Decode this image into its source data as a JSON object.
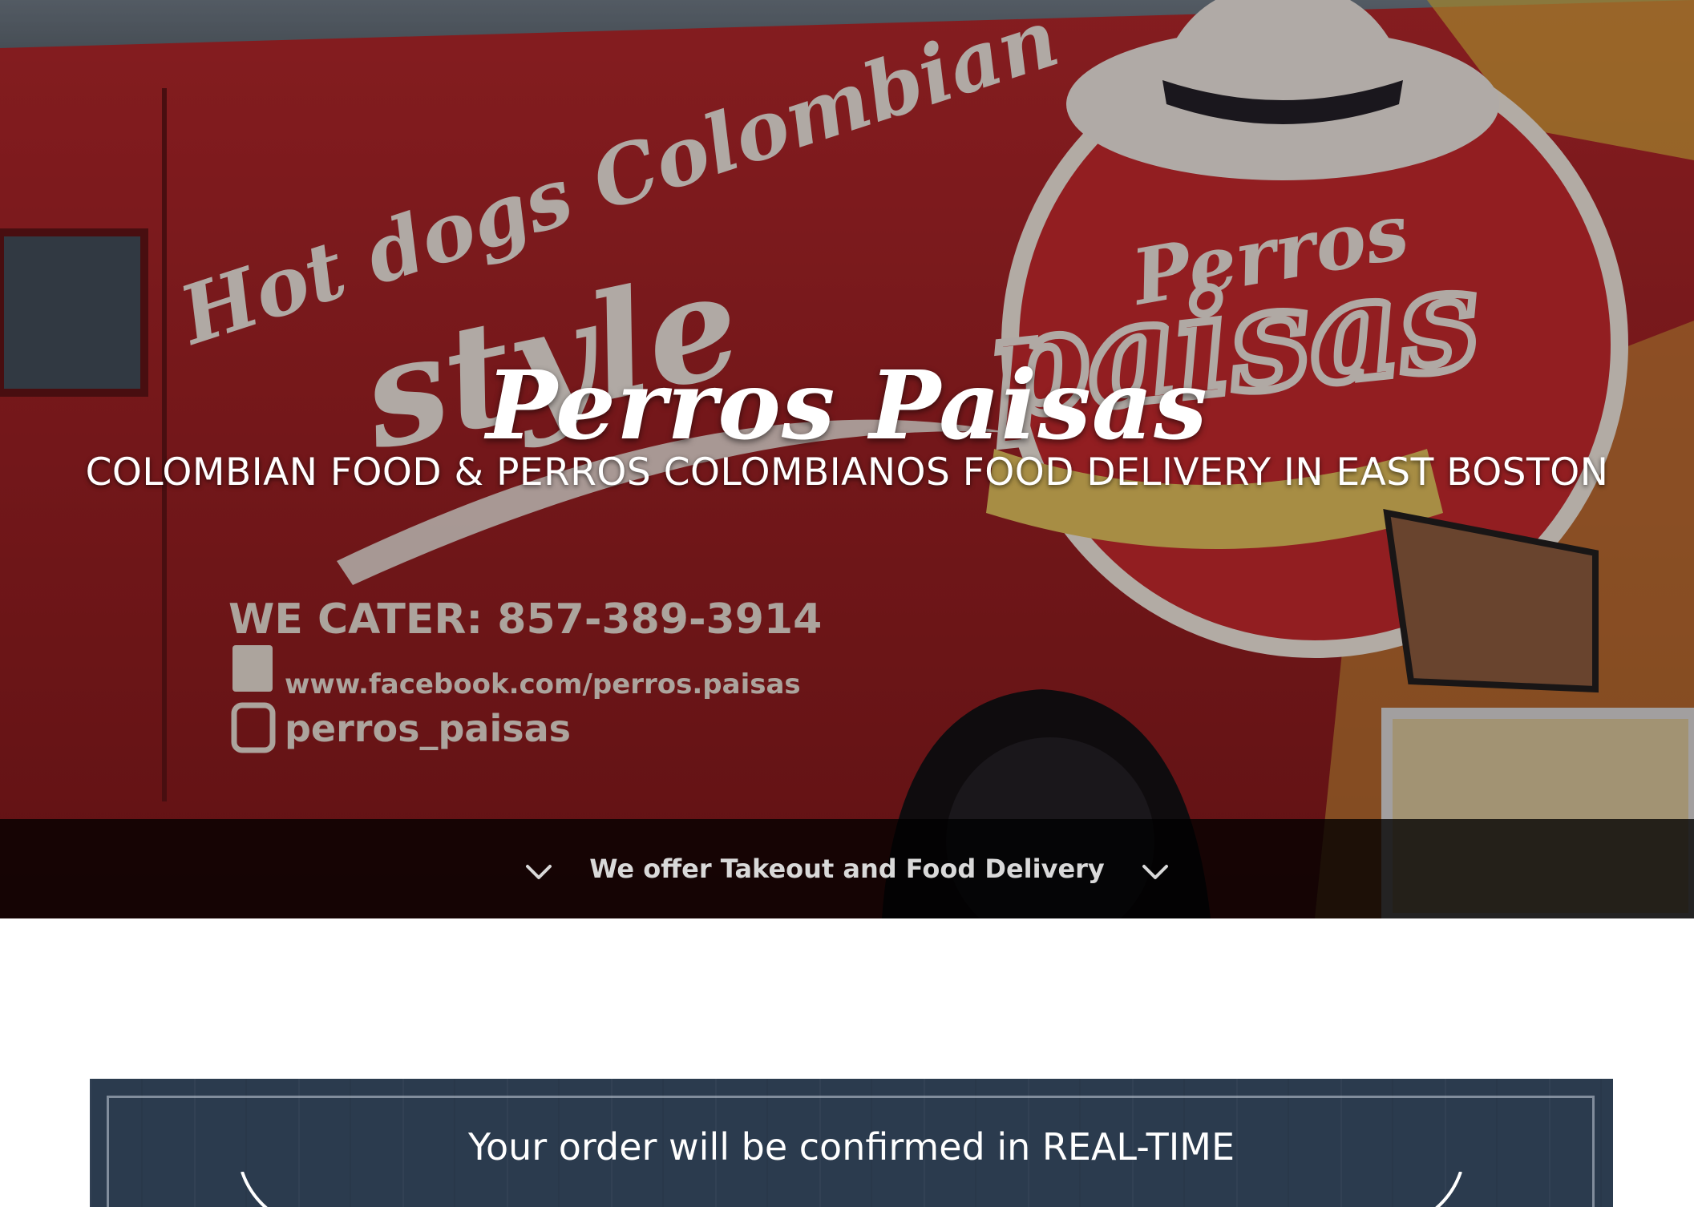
{
  "hero": {
    "title": "Perros Paisas",
    "subtitle": "COLOMBIAN FOOD & PERROS COLOMBIANOS FOOD DELIVERY IN EAST BOSTON",
    "bar_text": "We offer Takeout and Food Delivery",
    "truck_lettering": {
      "slogan_line1": "Hot dogs Colombian",
      "slogan_line2": "style",
      "cater_line": "WE CATER: 857-389-3914",
      "facebook": "www.facebook.com/perros.paisas",
      "instagram": "perros_paisas",
      "logo_top": "Perros",
      "logo_main": "paisas"
    }
  },
  "order_banner": {
    "text": "Your order will be confirmed in REAL-TIME"
  },
  "colors": {
    "truck_red": "#a61e22",
    "banner_navy": "#2b3b4e",
    "bar_black": "#000000",
    "text_white": "#ffffff"
  },
  "icons": {
    "bar_left": "chevron-down-icon",
    "bar_right": "chevron-down-icon"
  }
}
